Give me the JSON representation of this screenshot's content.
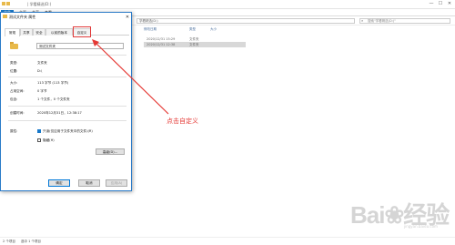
{
  "window": {
    "title": "| 学看精选(D:)",
    "min_glyph": "—",
    "max_glyph": "☐",
    "close_glyph": "✕"
  },
  "ribbon": {
    "tabs": [
      "文件",
      "主页",
      "共享",
      "查看"
    ],
    "file_color": "#1979ca"
  },
  "address": {
    "path": "学看精选(D:)",
    "search_placeholder": "搜索\"学看精选(D:)\""
  },
  "columns": [
    "修改日期",
    "类型",
    "大小"
  ],
  "files": [
    {
      "date": "2020/12/31 15:29",
      "type": "文件夹",
      "selected": false
    },
    {
      "date": "2020/12/31 12:38",
      "type": "文件夹",
      "selected": true
    }
  ],
  "status": {
    "count": "2 个项目",
    "selected": "选中 1 个项目"
  },
  "dialog": {
    "title": "测试文件夹 属性",
    "close": "✕",
    "tabs": [
      "常规",
      "共享",
      "安全",
      "以前的版本",
      "自定义"
    ],
    "name_value": "测试文件夹",
    "props": [
      {
        "label": "类型:",
        "value": "文件夹"
      },
      {
        "label": "位置:",
        "value": "D:\\"
      },
      {
        "label": "大小:",
        "value": "113 字节 (113 字节)"
      },
      {
        "label": "占用空间:",
        "value": "0 字节"
      },
      {
        "label": "包含:",
        "value": "1 个文件，0 个文件夹"
      },
      {
        "label": "创建时间:",
        "value": "2020年12月31日，12:38:17"
      }
    ],
    "attr_label": "属性:",
    "readonly_label": "只读(仅应用于文件夹中的文件)(R)",
    "readonly_checked": true,
    "hidden_label": "隐藏(H)",
    "hidden_checked": false,
    "advanced_label": "高级(D)...",
    "buttons": {
      "ok": "确定",
      "cancel": "取消",
      "apply": "应用(A)"
    }
  },
  "annotation": {
    "callout_text": "点击自定义",
    "color": "#e53935"
  },
  "watermark": {
    "text": "Bai❀经验",
    "sub": "jingyan.baidu.com"
  }
}
